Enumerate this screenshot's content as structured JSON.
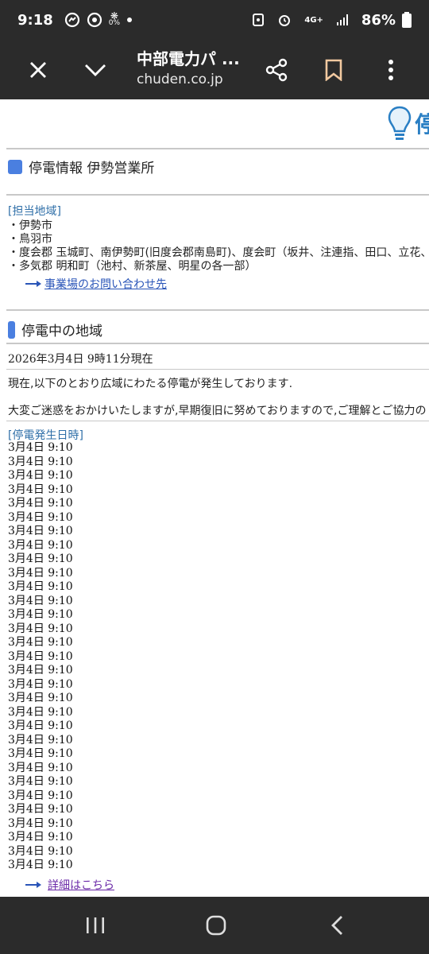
{
  "status": {
    "time": "9:18",
    "battery": "86%",
    "network": "4G+",
    "data_saver": "0%"
  },
  "browser": {
    "title": "中部電力パ ...",
    "url": "chuden.co.jp"
  },
  "logo": {
    "text": "停"
  },
  "office": {
    "title": "停電情報 伊勢営業所",
    "area_label": "[担当地域]",
    "areas": [
      "・伊勢市",
      "・鳥羽市",
      "・度会郡 玉城町、南伊勢町(旧度会郡南島町)、度会町（坂井、注連指、田口、立花、",
      "・多気郡 明和町（池村、新茶屋、明星の各一部）"
    ],
    "contact_link": "事業場のお問い合わせ先"
  },
  "outage": {
    "title": "停電中の地域",
    "as_of": "2026年3月4日 9時11分現在",
    "notice1": "現在,以下のとおり広域にわたる停電が発生しております.",
    "notice2": "大変ご迷惑をおかけいたしますが,早期復旧に努めておりますので,ご理解とご協力の",
    "time_label": "[停電発生日時]",
    "times": [
      "3月4日 9:10",
      "3月4日 9:10",
      "3月4日 9:10",
      "3月4日 9:10",
      "3月4日 9:10",
      "3月4日 9:10",
      "3月4日 9:10",
      "3月4日 9:10",
      "3月4日 9:10",
      "3月4日 9:10",
      "3月4日 9:10",
      "3月4日 9:10",
      "3月4日 9:10",
      "3月4日 9:10",
      "3月4日 9:10",
      "3月4日 9:10",
      "3月4日 9:10",
      "3月4日 9:10",
      "3月4日 9:10",
      "3月4日 9:10",
      "3月4日 9:10",
      "3月4日 9:10",
      "3月4日 9:10",
      "3月4日 9:10",
      "3月4日 9:10",
      "3月4日 9:10",
      "3月4日 9:10",
      "3月4日 9:10",
      "3月4日 9:10",
      "3月4日 9:10",
      "3月4日 9:10"
    ],
    "detail_link": "詳細はこちら"
  },
  "colors": {
    "bar_bg": "#2b2b2b",
    "accent_blue": "#4a7fe0",
    "label_blue": "#2f6fa8",
    "link": "#2a55b8",
    "visited_link": "#6b2aa8"
  }
}
